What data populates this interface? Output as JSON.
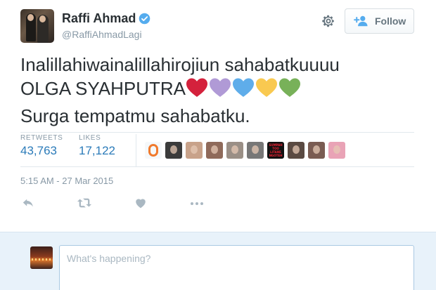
{
  "author": {
    "name": "Raffi Ahmad",
    "handle": "@RaffiAhmadLagi",
    "verified": true
  },
  "buttons": {
    "follow_label": "Follow",
    "settings_icon": "gear-icon",
    "follow_icon": "add-user-icon"
  },
  "tweet": {
    "line1": "Inalillahiwainalillahirojiun sahabatkuuuu",
    "line2": "OLGA SYAHPUTRA",
    "line3": "Surga tempatmu sahabatku.",
    "emoji_hearts": [
      {
        "name": "red-heart",
        "color": "#d4213c"
      },
      {
        "name": "purple-heart",
        "color": "#b09ad6"
      },
      {
        "name": "blue-heart",
        "color": "#5fadea"
      },
      {
        "name": "yellow-heart",
        "color": "#f9c950"
      },
      {
        "name": "green-heart",
        "color": "#78b159"
      }
    ]
  },
  "stats": {
    "retweets_label": "RETWEETS",
    "retweets_value": "43,763",
    "likes_label": "LIKES",
    "likes_value": "17,122"
  },
  "likers": [
    {
      "name": "liker-1",
      "color": "#f07a2d"
    },
    {
      "name": "liker-2",
      "color": "#3b3b3b"
    },
    {
      "name": "liker-3",
      "color": "#c8a28a"
    },
    {
      "name": "liker-4",
      "color": "#8f6a5a"
    },
    {
      "name": "liker-5",
      "color": "#9a8f86"
    },
    {
      "name": "liker-6",
      "color": "#777777"
    },
    {
      "name": "liker-7",
      "color": "#111111",
      "text": "SUMPAH TOO LITANE NGOTEH"
    },
    {
      "name": "liker-8",
      "color": "#5a4a42"
    },
    {
      "name": "liker-9",
      "color": "#7a5c52"
    },
    {
      "name": "liker-10",
      "color": "#e9a3b6"
    }
  ],
  "timestamp": "5:15 AM - 27 Mar 2015",
  "actions": {
    "reply_icon": "reply-icon",
    "retweet_icon": "retweet-icon",
    "like_icon": "heart-icon",
    "more_icon": "more-icon"
  },
  "compose": {
    "placeholder": "What's happening?"
  },
  "colors": {
    "link_blue": "#2b7bb9",
    "muted": "#8899a6",
    "text": "#292f33",
    "verified_blue": "#55acee",
    "compose_bg": "#e8f2fa"
  }
}
